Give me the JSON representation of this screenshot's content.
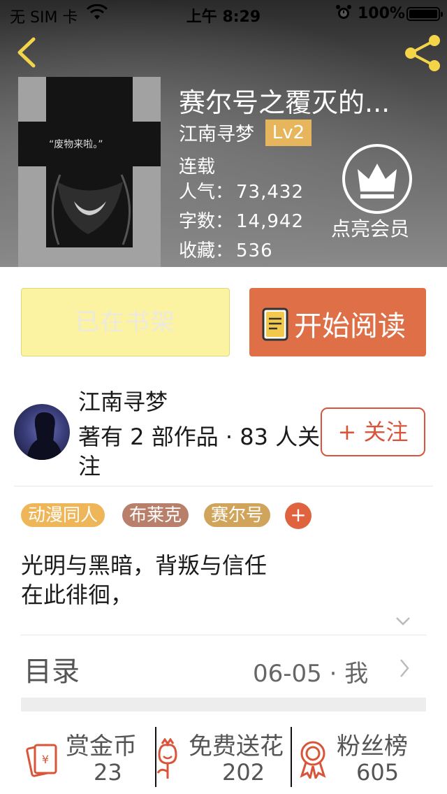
{
  "status_bar": {
    "carrier": "无 SIM 卡",
    "time": "上午 8:29",
    "battery": "100%"
  },
  "book": {
    "title": "赛尔号之覆灭的...",
    "author": "江南寻梦",
    "level": "Lv2",
    "status": "连载",
    "cover_text": "“废物来啦。”",
    "stats": [
      {
        "label": "人气：",
        "value": "73,432"
      },
      {
        "label": "字数：",
        "value": "14,942"
      },
      {
        "label": "收藏：",
        "value": "536"
      }
    ],
    "member_label": "点亮会员"
  },
  "actions": {
    "shelf_label": "已在书架",
    "read_label": "开始阅读"
  },
  "author_card": {
    "name": "江南寻梦",
    "meta": "著有 2 部作品 · 83 人关注",
    "follow_label": "+ 关注"
  },
  "tags": [
    {
      "label": "动漫同人",
      "color": "#eeb658"
    },
    {
      "label": "布莱克",
      "color": "#b87f6b"
    },
    {
      "label": "赛尔号",
      "color": "#d0a45a"
    }
  ],
  "tag_add_label": "+",
  "intro": {
    "line1": "光明与黑暗，背叛与信任",
    "line2": "在此徘徊，"
  },
  "toc": {
    "label": "目录",
    "meta": "06-05 · 我"
  },
  "bottom": [
    {
      "label": "赏金币",
      "value": "23"
    },
    {
      "label": "免费送花",
      "value": "202"
    },
    {
      "label": "粉丝榜",
      "value": "605"
    }
  ],
  "colors": {
    "accent": "#de6f47",
    "badge": "#e7b65c",
    "shelf_bg": "#fbf3a2"
  }
}
